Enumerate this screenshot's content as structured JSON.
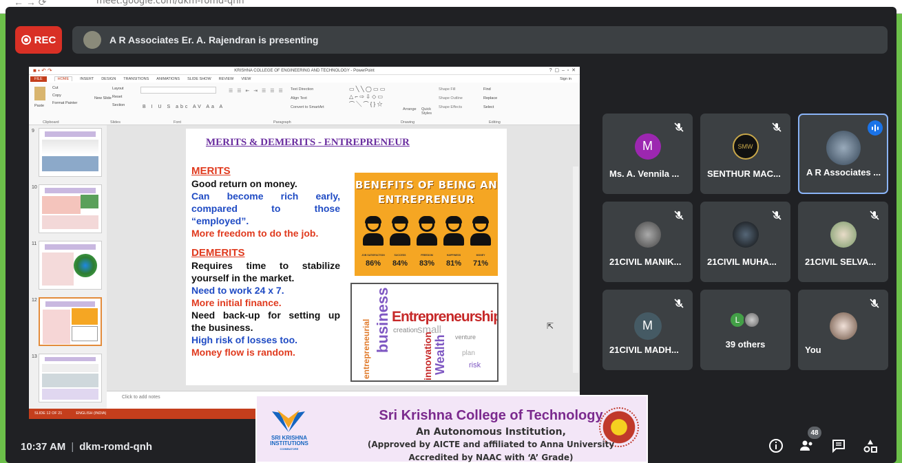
{
  "browser": {
    "url": "meet.google.com/dkm-romd-qnh"
  },
  "rec": {
    "label": "REC"
  },
  "presenter_bar": {
    "text": "A R Associates Er. A. Rajendran is presenting"
  },
  "powerpoint": {
    "window_title": "KRISHNA COLLEGE OF ENGINEERING AND TECHNOLOGY - PowerPoint",
    "tabs": [
      "FILE",
      "HOME",
      "INSERT",
      "DESIGN",
      "TRANSITIONS",
      "ANIMATIONS",
      "SLIDE SHOW",
      "REVIEW",
      "VIEW"
    ],
    "sign_in": "Sign in",
    "ribbon_groups": [
      "Clipboard",
      "Slides",
      "Font",
      "Paragraph",
      "Drawing",
      "Editing"
    ],
    "ribbon_items": {
      "paste": "Paste",
      "cut": "Cut",
      "copy": "Copy",
      "format_painter": "Format Painter",
      "new_slide": "New Slide",
      "layout": "Layout",
      "reset": "Reset",
      "section": "Section",
      "text_direction": "Text Direction",
      "align_text": "Align Text",
      "convert": "Convert to SmartArt",
      "arrange": "Arrange",
      "quick_styles": "Quick Styles",
      "shape_fill": "Shape Fill",
      "shape_outline": "Shape Outline",
      "shape_effects": "Shape Effects",
      "find": "Find",
      "replace": "Replace",
      "select": "Select"
    },
    "thumb_numbers": [
      "9",
      "10",
      "11",
      "12",
      "13"
    ],
    "notes_placeholder": "Click to add notes",
    "status_slide": "SLIDE 12 OF 21",
    "status_lang": "ENGLISH (INDIA)"
  },
  "slide": {
    "title": "MERITS & DEMERITS - ENTREPRENEUR",
    "merits_heading": "MERITS",
    "merit_1": "Good return on money.",
    "merit_2": "Can become rich early, compared to those",
    "merit_2b": "“employed”.",
    "merit_3": "More freedom to do the job.",
    "demerits_heading": "DEMERITS",
    "demerit_1": "Requires time to stabilize",
    "demerit_1b": "yourself in the market.",
    "demerit_2": "Need to work 24 x 7.",
    "demerit_3": "More initial finance.",
    "demerit_4": "Need back-up for setting up",
    "demerit_4b": "the business.",
    "demerit_5": "High risk of losses too.",
    "demerit_6": "Money flow is random.",
    "benefits_title_1": "BENEFITS OF BEING AN",
    "benefits_title_2": "ENTREPRENEUR",
    "benefits": [
      {
        "label": "JOB SATISFACTION",
        "pct": "86%"
      },
      {
        "label": "SUCCESS",
        "pct": "84%"
      },
      {
        "label": "FREEDOM",
        "pct": "83%"
      },
      {
        "label": "HAPPINESS",
        "pct": "81%"
      },
      {
        "label": "MONEY",
        "pct": "71%"
      }
    ],
    "wordcloud": {
      "main": "Entrepreneurship",
      "w1": "business",
      "w2": "entrepreneurial",
      "w3": "creation",
      "w4": "small",
      "w5": "Wealth",
      "w6": "innovation",
      "w7": "venture",
      "w8": "plan",
      "w9": "risk"
    }
  },
  "participants": [
    {
      "name": "Ms. A. Vennila ...",
      "initial": "M",
      "color": "#9c27b0",
      "muted": true
    },
    {
      "name": "SENTHUR MAC...",
      "initial": "SMW",
      "color": "#111111",
      "muted": true
    },
    {
      "name": "A R Associates ...",
      "initial": "",
      "color": "#5f6368",
      "speaking": true
    },
    {
      "name": "21CIVIL MANIK...",
      "initial": "",
      "color": "#7a7a7a",
      "muted": true
    },
    {
      "name": "21CIVIL MUHA...",
      "initial": "",
      "color": "#2b3b4c",
      "muted": true
    },
    {
      "name": "21CIVIL SELVA...",
      "initial": "",
      "color": "#b8a890",
      "muted": true
    },
    {
      "name": "21CIVIL MADH...",
      "initial": "M",
      "color": "#455a64",
      "muted": true
    },
    {
      "name": "39 others",
      "initial": "L",
      "color": "#43a047"
    },
    {
      "name": "You",
      "initial": "",
      "color": "#d8c8c0",
      "muted": true
    }
  ],
  "footer": {
    "time": "10:37 AM",
    "separator": "|",
    "meeting_code": "dkm-romd-qnh",
    "people_count": "48"
  },
  "banner": {
    "logo_text_1": "SRI KRISHNA",
    "logo_text_2": "INSTITUTIONS",
    "logo_text_3": "COIMBATORE",
    "line1": "Sri Krishna College of Technology",
    "line2": "An Autonomous Institution,",
    "line3": "(Approved by AICTE and affiliated to Anna University",
    "line4": "Accredited by NAAC with ‘A’ Grade)"
  }
}
